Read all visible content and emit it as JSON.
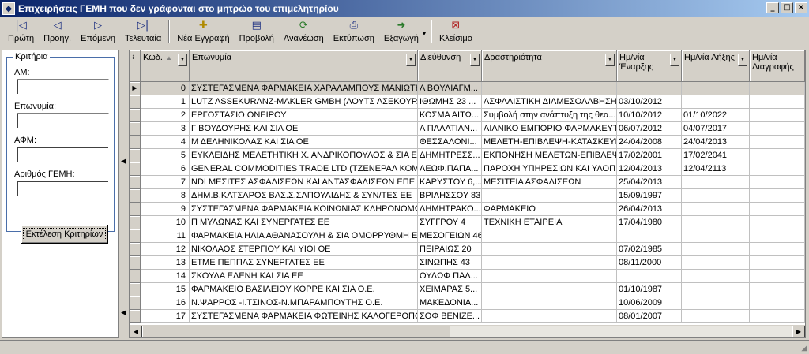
{
  "window": {
    "title": "Επιχειρήσεις ΓΕΜΗ που δεν γράφονται στο μητρώο του επιμελητηρίου",
    "min": "_",
    "max": "□",
    "close": "×"
  },
  "toolbar": {
    "first": "Πρώτη",
    "prev": "Προηγ.",
    "next": "Επόμενη",
    "last": "Τελευταία",
    "new": "Νέα Εγγραφή",
    "view": "Προβολή",
    "refresh": "Ανανέωση",
    "print": "Εκτύπωση",
    "export": "Εξαγωγή",
    "close": "Κλείσιμο"
  },
  "icons": {
    "first": "first-record-icon",
    "prev": "previous-record-icon",
    "next": "next-record-icon",
    "last": "last-record-icon",
    "new": "new-record-icon",
    "view": "view-icon",
    "refresh": "refresh-icon",
    "print": "printer-icon",
    "export": "export-icon",
    "close": "close-window-icon"
  },
  "filters": {
    "legend": "Κριτήρια",
    "am_label": "ΑΜ:",
    "am_value": "",
    "name_label": "Επωνυμία:",
    "name_value": "",
    "afm_label": "ΑΦΜ:",
    "afm_value": "",
    "gemi_label": "Αριθμός ΓΕΜΗ:",
    "gemi_value": "",
    "execute": "Εκτέλεση Κριτηρίων"
  },
  "grid": {
    "corner": "⁞",
    "columns": [
      "Κωδ.",
      "Επωνυμία",
      "Διεύθυνση",
      "Δραστηριότητα",
      "Ημ/νία Έναρξης",
      "Ημ/νία Λήξης",
      "Ημ/νία Διαγραφής"
    ],
    "rows": [
      [
        "0",
        "ΣΥΣΤΕΓΑΣΜΕΝΑ ΦΑΡΜΑΚΕΙΑ ΧΑΡΑΛΑΜΠΟΥΣ ΜΑΝΙΩΤΗ - ...",
        "Λ ΒΟΥΛΙΑΓΜ...",
        "",
        "",
        "",
        ""
      ],
      [
        "1",
        "LUTZ ASSEKURANZ-MAKLER GMBH (ΛΟΥΤΣ ΑΣΕΚΟΥΡΑΝΤ...",
        "ΙΘΩΜΗΣ 23 ...",
        "ΑΣΦΑΛΙΣΤΙΚΗ ΔΙΑΜΕΣΟΛΑΒΗΣΗ...",
        "03/10/2012",
        "",
        ""
      ],
      [
        "2",
        "ΕΡΓΟΣΤΑΣΙΟ ΟΝΕΙΡΟΥ",
        "ΚΟΣΜΑ ΑΙΤΩ...",
        "Συμβολή στην ανάπτυξη της θεα...",
        "10/10/2012",
        "01/10/2022",
        ""
      ],
      [
        "3",
        "Γ ΒΟΥΔΟΥΡΗΣ ΚΑΙ ΣΙΑ ΟΕ",
        "Λ ΠΑΛΑΤΙΑΝ...",
        "ΛΙΑΝΙΚΟ ΕΜΠΟΡΙΟ ΦΑΡΜΑΚΕΥΤ...",
        "06/07/2012",
        "04/07/2017",
        ""
      ],
      [
        "4",
        "Μ ΔΕΛΗΝΙΚΟΛΑΣ ΚΑΙ ΣΙΑ ΟΕ",
        "ΘΕΣΣΑΛΟΝΙ...",
        "ΜΕΛΕΤΗ-ΕΠΙΒΛΕΨΗ-ΚΑΤΑΣΚΕΥΗ...",
        "24/04/2008",
        "24/04/2013",
        ""
      ],
      [
        "5",
        "ΕΥΚΛΕΙΔΗΣ ΜΕΛΕΤΗΤΙΚΗ Χ. ΑΝΔΡΙΚΟΠΟΥΛΟΣ & ΣΙΑ Ε.Ε.",
        "ΔΗΜΗΤΡΕΣΣ...",
        "ΕΚΠΟΝΗΣΗ ΜΕΛΕΤΩΝ-ΕΠΙΒΛΕΨ...",
        "17/02/2001",
        "17/02/2041",
        ""
      ],
      [
        "6",
        "GENERAL COMMODITIES TRADE LTD (ΤΖΕΝΕΡΑΛ ΚΟΜΟΔ...",
        "ΛΕΩΦ.ΠΑΠΑ...",
        "ΠΑΡΟΧΗ ΥΠΗΡΕΣΙΩΝ ΚΑΙ ΥΛΟΠ...",
        "12/04/2013",
        "12/04/2113",
        ""
      ],
      [
        "7",
        "NDI ΜΕΣΙΤΕΣ ΑΣΦΑΛΙΣΕΩΝ ΚΑΙ ΑΝΤΑΣΦΑΛΙΣΕΩΝ ΕΠΕ (Ν...",
        "ΚΑΡΥΣΤΟΥ 6,...",
        "ΜΕΣΙΤΕΙΑ ΑΣΦΑΛΙΣΕΩΝ",
        "25/04/2013",
        "",
        ""
      ],
      [
        "8",
        "ΔΗΜ.Β.ΚΑΤΣΑΡΟΣ ΒΑΣ.Σ.ΣΑΠΟΥΛΙΔΗΣ & ΣΥΝ/ΤΕΣ ΕΕ",
        "ΒΡΙΛΗΣΣΟΥ 83",
        "",
        "15/09/1997",
        "",
        ""
      ],
      [
        "9",
        "ΣΥΣΤΕΓΑΣΜΕΝΑ ΦΑΡΜΑΚΕΙΑ ΚΟΙΝΩΝΙΑΣ ΚΛΗΡΟΝΟΜΩΝ ...",
        "ΔΗΜΗΤΡΑΚΟ...",
        "ΦΑΡΜΑΚΕΙΟ",
        "26/04/2013",
        "",
        ""
      ],
      [
        "10",
        "Π ΜΥΛΩΝΑΣ ΚΑΙ ΣΥΝΕΡΓΑΤΕΣ ΕΕ",
        "ΣΥΓΓΡΟΥ 4",
        "ΤΕΧΝΙΚΗ ΕΤΑΙΡΕΙΑ",
        "17/04/1980",
        "",
        ""
      ],
      [
        "11",
        "ΦΑΡΜΑΚΕΙΑ ΗΛΙΑ ΑΘΑΝΑΣΟΥΛΗ & ΣΙΑ ΟΜΟΡΡΥΘΜΗ ΕΤ...",
        "ΜΕΣΟΓΕΙΩΝ 46",
        "",
        "",
        "",
        ""
      ],
      [
        "12",
        "ΝΙΚΟΛΑΟΣ ΣΤΕΡΓΙΟΥ ΚΑΙ ΥΙΟΙ ΟΕ",
        "ΠΕΙΡΑΙΩΣ 20",
        "",
        "07/02/1985",
        "",
        ""
      ],
      [
        "13",
        "ΕΤΜΕ ΠΕΠΠΑΣ ΣΥΝΕΡΓΑΤΕΣ ΕΕ",
        "ΣΙΝΩΠΗΣ 43",
        "",
        "08/11/2000",
        "",
        ""
      ],
      [
        "14",
        "ΣΚΟΥΛΑ ΕΛΕΝΗ ΚΑΙ ΣΙΑ ΕΕ",
        "ΟΥΛΩΦ ΠΑΛ...",
        "",
        "",
        "",
        ""
      ],
      [
        "15",
        "ΦΑΡΜΑΚΕΙΟ ΒΑΣΙΛΕΙΟΥ ΚΟΡΡΕ ΚΑΙ ΣΙΑ Ο.Ε.",
        "ΧΕΙΜΑΡΑΣ 5...",
        "",
        "01/10/1987",
        "",
        ""
      ],
      [
        "16",
        "Ν.ΨΑΡΡΟΣ -Ι.ΤΣΙΝΟΣ-Ν.ΜΠΑΡΑΜΠΟΥΤΗΣ Ο.Ε.",
        "ΜΑΚΕΔΟΝΙΑ...",
        "",
        "10/06/2009",
        "",
        ""
      ],
      [
        "17",
        "ΣΥΣΤΕΓΑΣΜΕΝΑ ΦΑΡΜΑΚΕΙΑ ΦΩΤΕΙΝΗΣ ΚΑΛΟΓΕΡΟΠΟΥ...",
        "ΣΟΦ ΒΕΝΙΖΕ...",
        "",
        "08/01/2007",
        "",
        ""
      ]
    ]
  }
}
